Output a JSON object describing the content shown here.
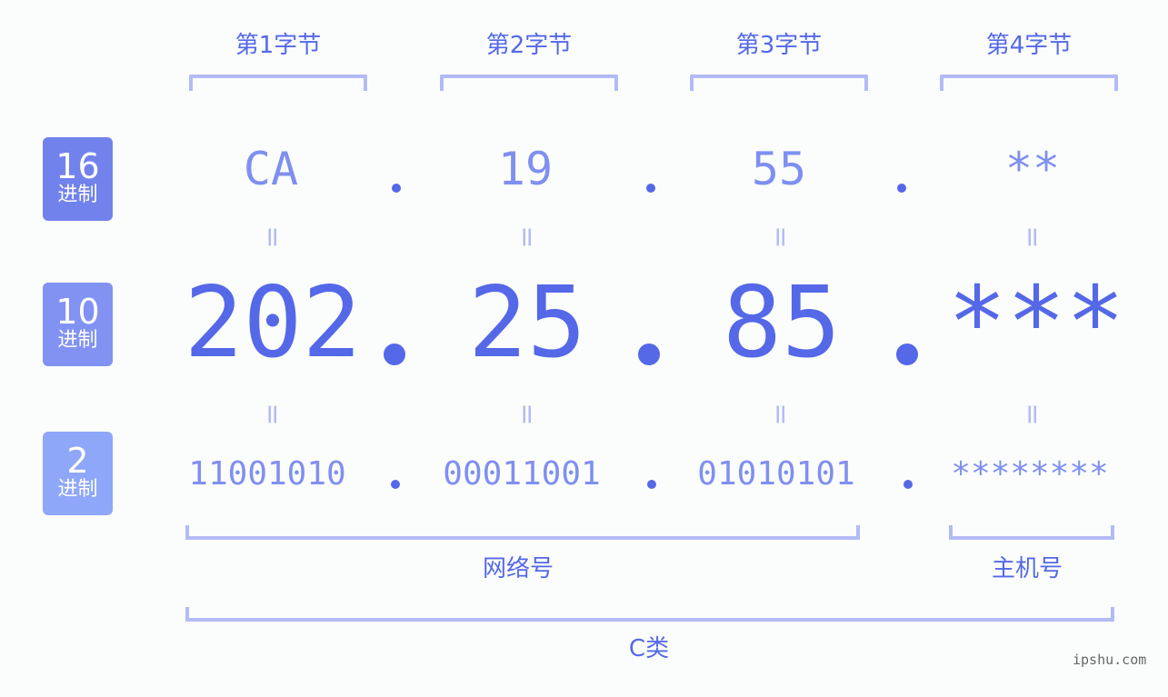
{
  "bytes": [
    {
      "label": "第1字节",
      "hex": "CA",
      "dec": "202",
      "bin": "11001010"
    },
    {
      "label": "第2字节",
      "hex": "19",
      "dec": "25",
      "bin": "00011001"
    },
    {
      "label": "第3字节",
      "hex": "55",
      "dec": "85",
      "bin": "01010101"
    },
    {
      "label": "第4字节",
      "hex": "**",
      "dec": "***",
      "bin": "********"
    }
  ],
  "rows": [
    {
      "base": "16",
      "unit": "进制",
      "color": "#7282ec"
    },
    {
      "base": "10",
      "unit": "进制",
      "color": "#8292f2"
    },
    {
      "base": "2",
      "unit": "进制",
      "color": "#8fa7f8"
    }
  ],
  "equals_sign": "=",
  "segments": {
    "network": "网络号",
    "host": "主机号",
    "class": "C类"
  },
  "watermark": "ipshu.com",
  "colors": {
    "primary": "#5468e8",
    "light": "#7f8ff0",
    "bracket": "#b3bbf5"
  }
}
